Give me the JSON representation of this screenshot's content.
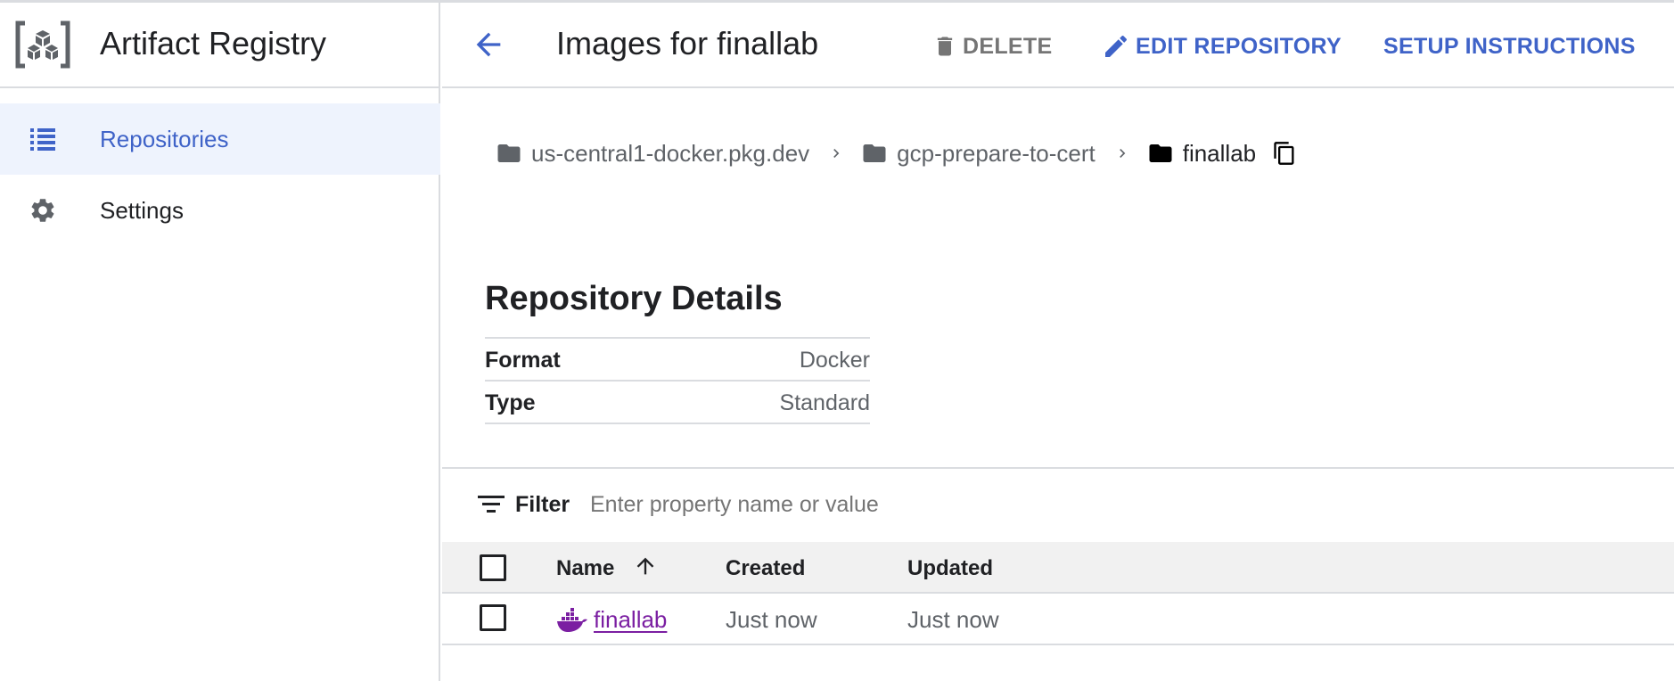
{
  "app": {
    "title": "Artifact Registry"
  },
  "sidebar": {
    "items": [
      {
        "label": "Repositories",
        "icon": "list-icon",
        "active": true
      },
      {
        "label": "Settings",
        "icon": "gear-icon",
        "active": false
      }
    ]
  },
  "header": {
    "title": "Images for finallab",
    "delete_label": "DELETE",
    "edit_label": "EDIT REPOSITORY",
    "setup_label": "SETUP INSTRUCTIONS"
  },
  "breadcrumb": {
    "items": [
      "us-central1-docker.pkg.dev",
      "gcp-prepare-to-cert",
      "finallab"
    ]
  },
  "details": {
    "title": "Repository Details",
    "rows": [
      {
        "key": "Format",
        "value": "Docker"
      },
      {
        "key": "Type",
        "value": "Standard"
      }
    ]
  },
  "filter": {
    "label": "Filter",
    "placeholder": "Enter property name or value"
  },
  "table": {
    "columns": [
      "Name",
      "Created",
      "Updated"
    ],
    "sort": {
      "column": "Name",
      "direction": "ascending"
    },
    "rows": [
      {
        "name": "finallab",
        "created": "Just now",
        "updated": "Just now",
        "icon": "docker-icon"
      }
    ]
  },
  "colors": {
    "accent": "#3f63c8",
    "active_nav_bg": "#eef3fd",
    "link_purple": "#7b1fa2",
    "border": "#dadce0",
    "muted_text": "#5f6368"
  }
}
